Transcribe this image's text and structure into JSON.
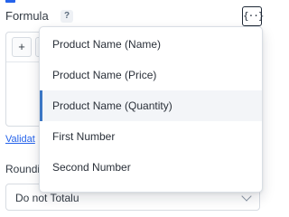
{
  "formula": {
    "label": "Formula",
    "help": "?",
    "variable_button": "{··}"
  },
  "editor": {
    "toolbar": [
      "+",
      ""
    ]
  },
  "validate_link": "Validat",
  "rounding": {
    "label": "Roundi",
    "select_value": "Do not Totalu"
  },
  "dropdown": {
    "active_index": 2,
    "items": [
      {
        "label": "Product Name (Name)"
      },
      {
        "label": "Product Name (Price)"
      },
      {
        "label": "Product Name (Quantity)"
      },
      {
        "label": "First Number"
      },
      {
        "label": "Second Number"
      }
    ]
  },
  "colors": {
    "accent": "#2563eb",
    "active_indicator": "#3b76c4",
    "active_background": "#f3f5f8"
  }
}
